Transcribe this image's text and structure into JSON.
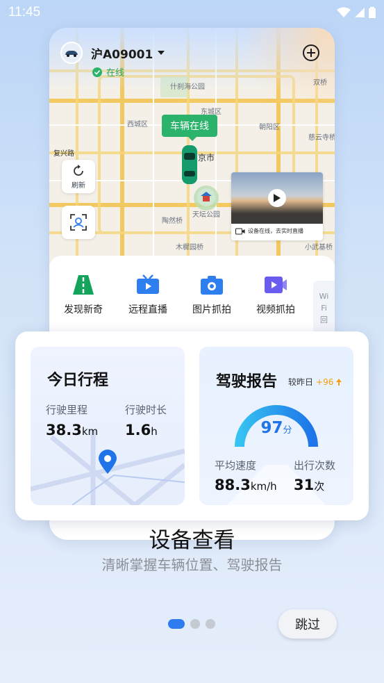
{
  "status_bar": {
    "time": "11:45"
  },
  "vehicle": {
    "plate": "沪A09001",
    "status": "在线"
  },
  "map": {
    "car_tag": "车辆在线",
    "labels": [
      "东城区",
      "朝阳区",
      "西城区",
      "京市",
      "天坛公园",
      "复兴路",
      "什刹海公园",
      "陶然桥",
      "木樨园桥",
      "小武基桥",
      "慈云寺桥",
      "双桥"
    ]
  },
  "side_buttons": {
    "refresh": "刷新"
  },
  "video_preview": {
    "caption": "设备在线，去实时直播"
  },
  "quick_actions": [
    {
      "label": "发现新奇",
      "icon": "road-icon",
      "color": "#14a35a"
    },
    {
      "label": "远程直播",
      "icon": "tv-icon",
      "color": "#2d7ff0"
    },
    {
      "label": "图片抓拍",
      "icon": "camera-icon",
      "color": "#2d7ff0"
    },
    {
      "label": "视频抓拍",
      "icon": "video-icon",
      "color": "#6a5cf0"
    }
  ],
  "side_tab": {
    "lines": [
      "Wi",
      "Fi",
      "回"
    ]
  },
  "trip": {
    "title": "今日行程",
    "mileage_label": "行驶里程",
    "mileage_value": "38.3",
    "mileage_unit": "km",
    "duration_label": "行驶时长",
    "duration_value": "1.6",
    "duration_unit": "h"
  },
  "report": {
    "title": "驾驶报告",
    "compare_label": "较昨日",
    "compare_value": "+96",
    "score": "97",
    "score_unit": "分",
    "speed_label": "平均速度",
    "speed_value": "88.3",
    "speed_unit": "km/h",
    "trips_label": "出行次数",
    "trips_value": "31",
    "trips_unit": "次"
  },
  "onboarding": {
    "title": "设备查看",
    "subtitle": "清晰掌握车辆位置、驾驶报告",
    "pages": 3,
    "active_page": 1,
    "skip": "跳过"
  },
  "colors": {
    "accent": "#2f7bf0",
    "online": "#2bb36c"
  }
}
